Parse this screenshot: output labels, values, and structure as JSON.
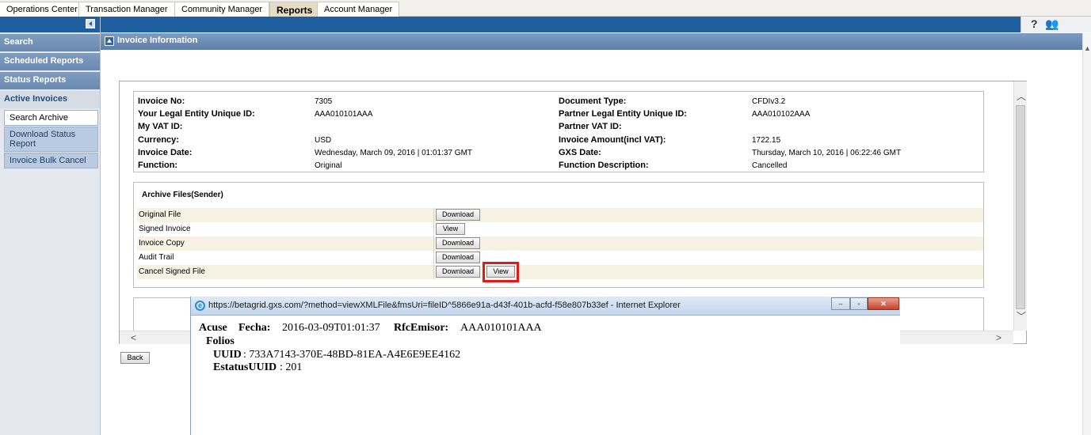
{
  "tabs": [
    {
      "label": "Operations Center",
      "active": false
    },
    {
      "label": "Transaction Manager",
      "active": false
    },
    {
      "label": "Community Manager",
      "active": false
    },
    {
      "label": "Reports",
      "active": true
    },
    {
      "label": "Account Manager",
      "active": false
    }
  ],
  "sidebar": {
    "sections": [
      "Search",
      "Scheduled Reports",
      "Status Reports",
      "Active Invoices"
    ],
    "items": [
      "Search Archive",
      "Download Status Report",
      "Invoice Bulk Cancel"
    ]
  },
  "header": {
    "help_icon": "?",
    "people_icon": "👥"
  },
  "page": {
    "title": "Invoice Information"
  },
  "invoice": {
    "labels": {
      "invoice_no": "Invoice No:",
      "your_legal_id": "Your Legal Entity Unique ID:",
      "my_vat": "My VAT ID:",
      "currency": "Currency:",
      "invoice_date": "Invoice Date:",
      "function": "Function:",
      "document_type": "Document Type:",
      "partner_legal_id": "Partner Legal Entity Unique ID:",
      "partner_vat": "Partner VAT ID:",
      "invoice_amount": "Invoice Amount(incl VAT):",
      "gxs_date": "GXS Date:",
      "function_description": "Function Description:"
    },
    "values": {
      "invoice_no": "7305",
      "your_legal_id": "AAA010101AAA",
      "my_vat": "",
      "currency": "USD",
      "invoice_date": "Wednesday, March 09, 2016 | 01:01:37 GMT",
      "function": "Original",
      "document_type": "CFDIv3.2",
      "partner_legal_id": "AAA010102AAA",
      "partner_vat": "",
      "invoice_amount": "1722.15",
      "gxs_date": "Thursday, March 10, 2016 | 06:22:46 GMT",
      "function_description": "Cancelled"
    }
  },
  "archive": {
    "title": "Archive Files(Sender)",
    "rows": [
      {
        "label": "Original File",
        "buttons": [
          "Download"
        ]
      },
      {
        "label": "Signed Invoice",
        "buttons": [
          "View"
        ]
      },
      {
        "label": "Invoice Copy",
        "buttons": [
          "Download"
        ]
      },
      {
        "label": "Audit Trail",
        "buttons": [
          "Download"
        ]
      },
      {
        "label": "Cancel Signed File",
        "buttons": [
          "Download",
          "View"
        ]
      }
    ]
  },
  "back_label": "Back",
  "popup": {
    "title": "https://betagrid.gxs.com/?method=viewXMLFile&fmsUri=fileID^5866e91a-d43f-401b-acfd-f58e807b33ef - Internet Explorer",
    "acuse": "Acuse",
    "fecha_label": "Fecha:",
    "fecha_value": "2016-03-09T01:01:37",
    "rfc_label": "RfcEmisor:",
    "rfc_value": "AAA010101AAA",
    "folios": "Folios",
    "uuid_label": "UUID",
    "uuid_value": ": 733A7143-370E-48BD-81EA-A4E6E9EE4162",
    "estatus_label": "EstatusUUID",
    "estatus_value": ": 201",
    "minimize": "–",
    "maximize": "▫",
    "close": "✕"
  },
  "colors": {
    "nav_blue": "#1f5fa0",
    "highlight": "#e0191d",
    "active_tab": "#e6dcc3"
  }
}
